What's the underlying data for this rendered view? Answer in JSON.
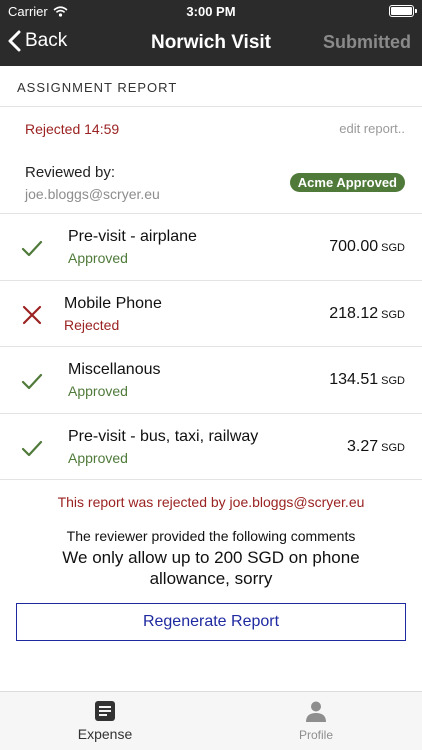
{
  "status_bar": {
    "carrier": "Carrier",
    "time": "3:00 PM"
  },
  "nav": {
    "back_label": "Back",
    "title": "Norwich Visit",
    "right_label": "Submitted"
  },
  "section": {
    "header": "ASSIGNMENT REPORT"
  },
  "report": {
    "rejected_line": "Rejected 14:59",
    "edit_link": "edit report..",
    "reviewed_by_label": "Reviewed by:",
    "reviewer_email": "joe.bloggs@scryer.eu",
    "badge": "Acme Approved",
    "badge_color": "#4f7a3a"
  },
  "items": [
    {
      "title": "Pre-visit - airplane",
      "status": "Approved",
      "amount": "700.00",
      "currency": "SGD",
      "icon": "check-icon"
    },
    {
      "title": "Mobile Phone",
      "status": "Rejected",
      "amount": "218.12",
      "currency": "SGD",
      "icon": "cross-icon"
    },
    {
      "title": "Miscellanous",
      "status": "Approved",
      "amount": "134.51",
      "currency": "SGD",
      "icon": "check-icon"
    },
    {
      "title": "Pre-visit - bus, taxi, railway",
      "status": "Approved",
      "amount": "3.27",
      "currency": "SGD",
      "icon": "check-icon"
    }
  ],
  "rejection": {
    "message": "This report was rejected by joe.bloggs@scryer.eu",
    "comments_label": "The reviewer provided the following comments",
    "comment": "We only allow up to 200 SGD on phone allowance, sorry"
  },
  "actions": {
    "regenerate_label": "Regenerate Report"
  },
  "tabbar": {
    "expense_label": "Expense",
    "profile_label": "Profile"
  },
  "colors": {
    "approved": "#4f7a3a",
    "rejected": "#9b2222",
    "accent": "#1f2aa0",
    "header_bg": "#2b2b2b"
  }
}
